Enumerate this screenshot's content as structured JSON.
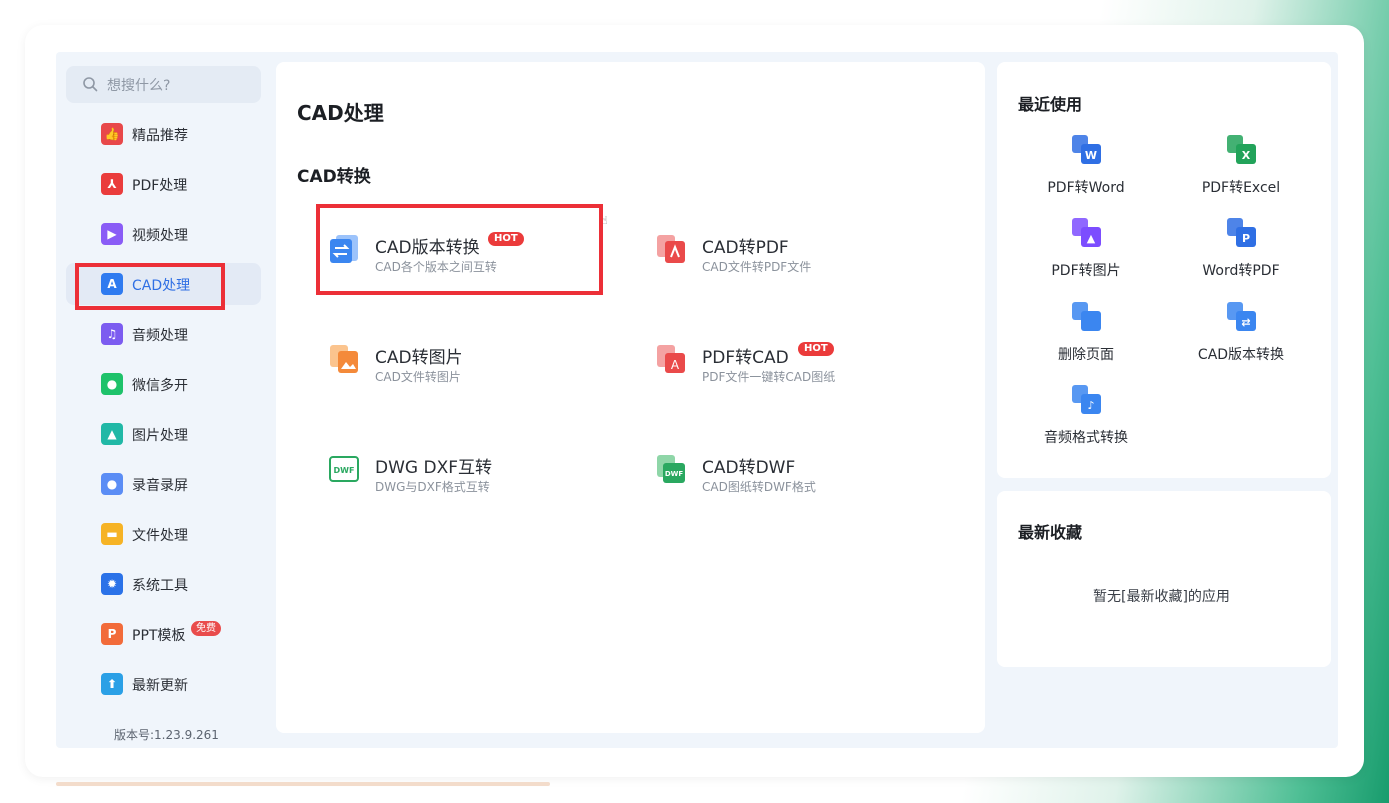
{
  "search": {
    "placeholder": "想搜什么?"
  },
  "sidebar": {
    "items": [
      {
        "label": "精品推荐",
        "icon": "thumbs-up-icon",
        "color": "#e8484a"
      },
      {
        "label": "PDF处理",
        "icon": "pdf-icon",
        "color": "#ea3c3c"
      },
      {
        "label": "视频处理",
        "icon": "play-icon",
        "color": "#8a5cf6"
      },
      {
        "label": "CAD处理",
        "icon": "cad-icon",
        "color": "#2f7bf0",
        "active": true
      },
      {
        "label": "音频处理",
        "icon": "music-icon",
        "color": "#7c5cf0"
      },
      {
        "label": "微信多开",
        "icon": "wechat-icon",
        "color": "#1ec26a"
      },
      {
        "label": "图片处理",
        "icon": "image-icon",
        "color": "#21b8a6"
      },
      {
        "label": "录音录屏",
        "icon": "microphone-icon",
        "color": "#5b8df5"
      },
      {
        "label": "文件处理",
        "icon": "folder-icon",
        "color": "#f6b325"
      },
      {
        "label": "系统工具",
        "icon": "gear-icon",
        "color": "#2b72e8"
      },
      {
        "label": "PPT模板",
        "icon": "ppt-icon",
        "color": "#f26b3a",
        "badge": "免费"
      },
      {
        "label": "最新更新",
        "icon": "upload-icon",
        "color": "#2ba0e6"
      }
    ],
    "version": "版本号:1.23.9.261"
  },
  "main": {
    "title": "CAD处理",
    "section": "CAD转换",
    "tools": [
      {
        "name": "CAD版本转换",
        "desc": "CAD各个版本之间互转",
        "badge": "HOT",
        "icon": "swap-icon"
      },
      {
        "name": "CAD转PDF",
        "desc": "CAD文件转PDF文件",
        "badge": "",
        "icon": "cad-to-pdf-icon"
      },
      {
        "name": "CAD转图片",
        "desc": "CAD文件转图片",
        "badge": "",
        "icon": "cad-to-image-icon"
      },
      {
        "name": "PDF转CAD",
        "desc": "PDF文件一键转CAD图纸",
        "badge": "HOT",
        "icon": "pdf-to-cad-icon"
      },
      {
        "name": "DWG DXF互转",
        "desc": "DWG与DXF格式互转",
        "badge": "",
        "icon": "dwf-icon"
      },
      {
        "name": "CAD转DWF",
        "desc": "CAD图纸转DWF格式",
        "badge": "",
        "icon": "cad-to-dwf-icon"
      }
    ]
  },
  "recent": {
    "title": "最近使用",
    "items": [
      {
        "label": "PDF转Word",
        "icon": "pdf-to-word-icon",
        "letter": "W",
        "color": "#2f6fe4"
      },
      {
        "label": "PDF转Excel",
        "icon": "pdf-to-excel-icon",
        "letter": "X",
        "color": "#22a35a"
      },
      {
        "label": "PDF转图片",
        "icon": "pdf-to-image-icon",
        "letter": "▲",
        "color": "#7c4dff"
      },
      {
        "label": "Word转PDF",
        "icon": "word-to-pdf-icon",
        "letter": "P",
        "color": "#2f6fe4"
      },
      {
        "label": "删除页面",
        "icon": "delete-page-icon",
        "letter": "",
        "color": "#3b86f0"
      },
      {
        "label": "CAD版本转换",
        "icon": "cad-version-icon",
        "letter": "⇄",
        "color": "#3b86f0"
      },
      {
        "label": "音频格式转换",
        "icon": "audio-convert-icon",
        "letter": "♪",
        "color": "#3b86f0"
      }
    ]
  },
  "favorites": {
    "title": "最新收藏",
    "empty": "暂无[最新收藏]的应用"
  },
  "colors": {
    "accent": "#2f6fe4",
    "highlight": "#ec2f37"
  }
}
